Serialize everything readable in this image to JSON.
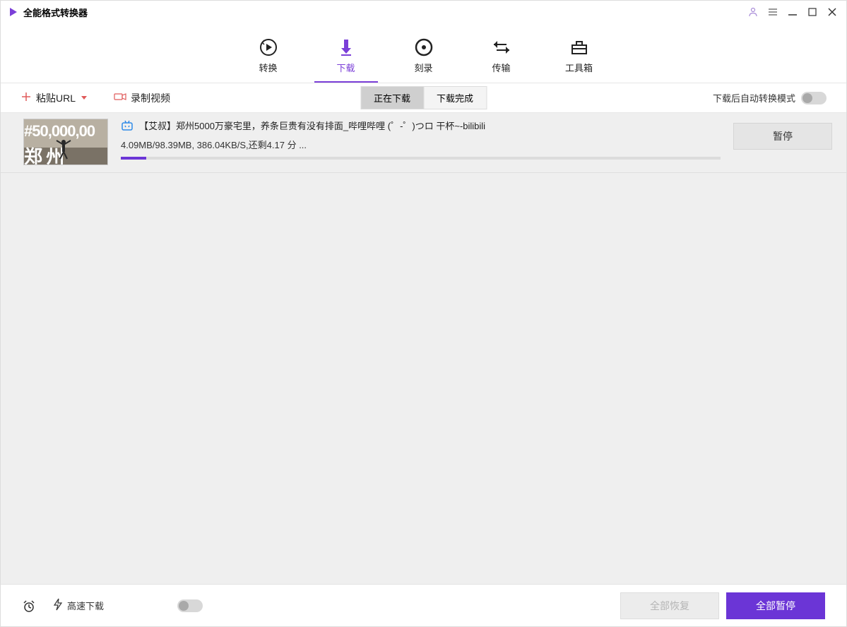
{
  "app": {
    "title": "全能格式转换器"
  },
  "tabs": [
    {
      "key": "convert",
      "label": "转换"
    },
    {
      "key": "download",
      "label": "下载"
    },
    {
      "key": "burn",
      "label": "刻录"
    },
    {
      "key": "transfer",
      "label": "传输"
    },
    {
      "key": "toolbox",
      "label": "工具箱"
    }
  ],
  "subbar": {
    "paste_url": "粘贴URL",
    "record_video": "录制视频",
    "downloading": "正在下载",
    "completed": "下载完成",
    "auto_convert_label": "下载后自动转换模式"
  },
  "downloads": [
    {
      "source": "bilibili",
      "title": "【艾叔】郑州5000万豪宅里，养条巨贵有没有排面_哔哩哔哩 (゜-゜)つロ 干杯~-bilibili",
      "status_text": "4.09MB/98.39MB, 386.04KB/S,还剩4.17 分 ...",
      "progress_percent": 4.2,
      "pause_label": "暂停",
      "thumb_text": "50,000,00"
    }
  ],
  "footer": {
    "fast_download": "高速下载",
    "resume_all": "全部恢复",
    "pause_all": "全部暂停"
  }
}
